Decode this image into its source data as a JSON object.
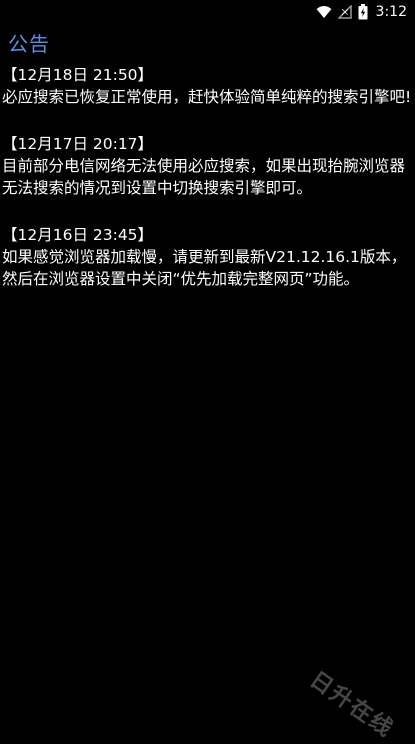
{
  "status_bar": {
    "time": "3:12",
    "icons": [
      "wifi-icon",
      "no-signal-icon",
      "battery-charging-icon"
    ]
  },
  "page": {
    "title": "公告"
  },
  "notices": [
    {
      "date": "【12月18日 21:50】",
      "body": "必应搜索已恢复正常使用，赶快体验简单纯粹的搜索引擎吧!"
    },
    {
      "date": "【12月17日 20:17】",
      "body": "目前部分电信网络无法使用必应搜索，如果出现抬腕浏览器无法搜索的情况到设置中切换搜索引擎即可。"
    },
    {
      "date": "【12月16日 23:45】",
      "body": "如果感觉浏览器加载慢，请更新到最新V21.12.16.1版本，然后在浏览器设置中关闭“优先加载完整网页”功能。"
    }
  ],
  "watermark": "日升在线",
  "colors": {
    "background": "#000000",
    "title": "#5b8fe6",
    "text": "#ffffff"
  }
}
